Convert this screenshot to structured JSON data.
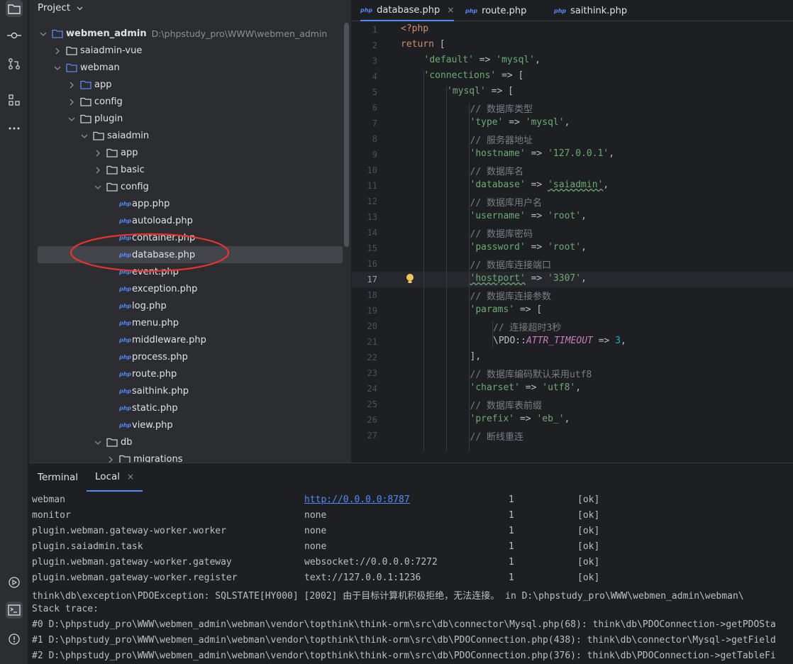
{
  "project_panel": {
    "title": "Project",
    "tree": [
      {
        "label": "webmen_admin",
        "path": "D:\\phpstudy_pro\\WWW\\webmen_admin"
      },
      {
        "label": "saiadmin-vue"
      },
      {
        "label": "webman"
      },
      {
        "label": "app"
      },
      {
        "label": "config"
      },
      {
        "label": "plugin"
      },
      {
        "label": "saiadmin"
      },
      {
        "label": "app"
      },
      {
        "label": "basic"
      },
      {
        "label": "config"
      },
      {
        "label": "app.php"
      },
      {
        "label": "autoload.php"
      },
      {
        "label": "container.php"
      },
      {
        "label": "database.php"
      },
      {
        "label": "event.php"
      },
      {
        "label": "exception.php"
      },
      {
        "label": "log.php"
      },
      {
        "label": "menu.php"
      },
      {
        "label": "middleware.php"
      },
      {
        "label": "process.php"
      },
      {
        "label": "route.php"
      },
      {
        "label": "saithink.php"
      },
      {
        "label": "static.php"
      },
      {
        "label": "view.php"
      },
      {
        "label": "db"
      },
      {
        "label": "migrations"
      }
    ]
  },
  "editor": {
    "tabs": [
      {
        "icon": "php",
        "label": "database.php",
        "close": "×"
      },
      {
        "icon": "php",
        "label": "route.php"
      },
      {
        "icon": "php",
        "label": "saithink.php"
      }
    ],
    "line_numbers": [
      "1",
      "2",
      "3",
      "4",
      "5",
      "6",
      "7",
      "8",
      "9",
      "10",
      "11",
      "12",
      "13",
      "14",
      "15",
      "16",
      "17",
      "18",
      "19",
      "20",
      "21",
      "22",
      "23",
      "24",
      "25",
      "26",
      "27"
    ],
    "code": [
      "<?php",
      "return [",
      "'default' => 'mysql',",
      "'connections' => [",
      "'mysql' => [",
      "// 数据库类型",
      "'type' => 'mysql',",
      "// 服务器地址",
      "'hostname' => '127.0.0.1',",
      "// 数据库名",
      "'database' => 'saiadmin',",
      "// 数据库用户名",
      "'username' => 'root',",
      "// 数据库密码",
      "'password' => 'root',",
      "// 数据库连接端口",
      "'hostport' => '3307',",
      "// 数据库连接参数",
      "'params' => [",
      "// 连接超时3秒",
      "\\PDO::ATTR_TIMEOUT => 3,",
      "],",
      "// 数据库编码默认采用utf8",
      "'charset' => 'utf8',",
      "// 数据库表前缀",
      "'prefix' => 'eb_',",
      "// 断线重连"
    ]
  },
  "terminal": {
    "tab_title": "Terminal",
    "session_tab": "Local",
    "session_close": "×",
    "rows": [
      {
        "name": "webman",
        "listen": "http://0.0.0.0:8787",
        "count": "1",
        "status": "[ok]"
      },
      {
        "name": "monitor",
        "listen": "none",
        "count": "1",
        "status": "[ok]"
      },
      {
        "name": "plugin.webman.gateway-worker.worker",
        "listen": "none",
        "count": "1",
        "status": "[ok]"
      },
      {
        "name": "plugin.saiadmin.task",
        "listen": "none",
        "count": "1",
        "status": "[ok]"
      },
      {
        "name": "plugin.webman.gateway-worker.gateway",
        "listen": "websocket://0.0.0.0:7272",
        "count": "1",
        "status": "[ok]"
      },
      {
        "name": "plugin.webman.gateway-worker.register",
        "listen": "text://127.0.0.1:1236",
        "count": "1",
        "status": "[ok]"
      }
    ],
    "error_lines": [
      "think\\db\\exception\\PDOException: SQLSTATE[HY000] [2002] 由于目标计算机积极拒绝，无法连接。 in D:\\phpstudy_pro\\WWW\\webmen_admin\\webman\\",
      "Stack trace:",
      "#0 D:\\phpstudy_pro\\WWW\\webmen_admin\\webman\\vendor\\topthink\\think-orm\\src\\db\\connector\\Mysql.php(68): think\\db\\PDOConnection->getPDOSta",
      "#1 D:\\phpstudy_pro\\WWW\\webmen_admin\\webman\\vendor\\topthink\\think-orm\\src\\db\\PDOConnection.php(438): think\\db\\connector\\Mysql->getField",
      "#2 D:\\phpstudy_pro\\WWW\\webmen_admin\\webman\\vendor\\topthink\\think-orm\\src\\db\\PDOConnection.php(376): think\\db\\PDOConnection->getTableFi"
    ]
  },
  "colors": {
    "accent": "#548af7",
    "annotation": "#e8332f",
    "background": "#1e1f22",
    "panel": "#2b2d30"
  }
}
